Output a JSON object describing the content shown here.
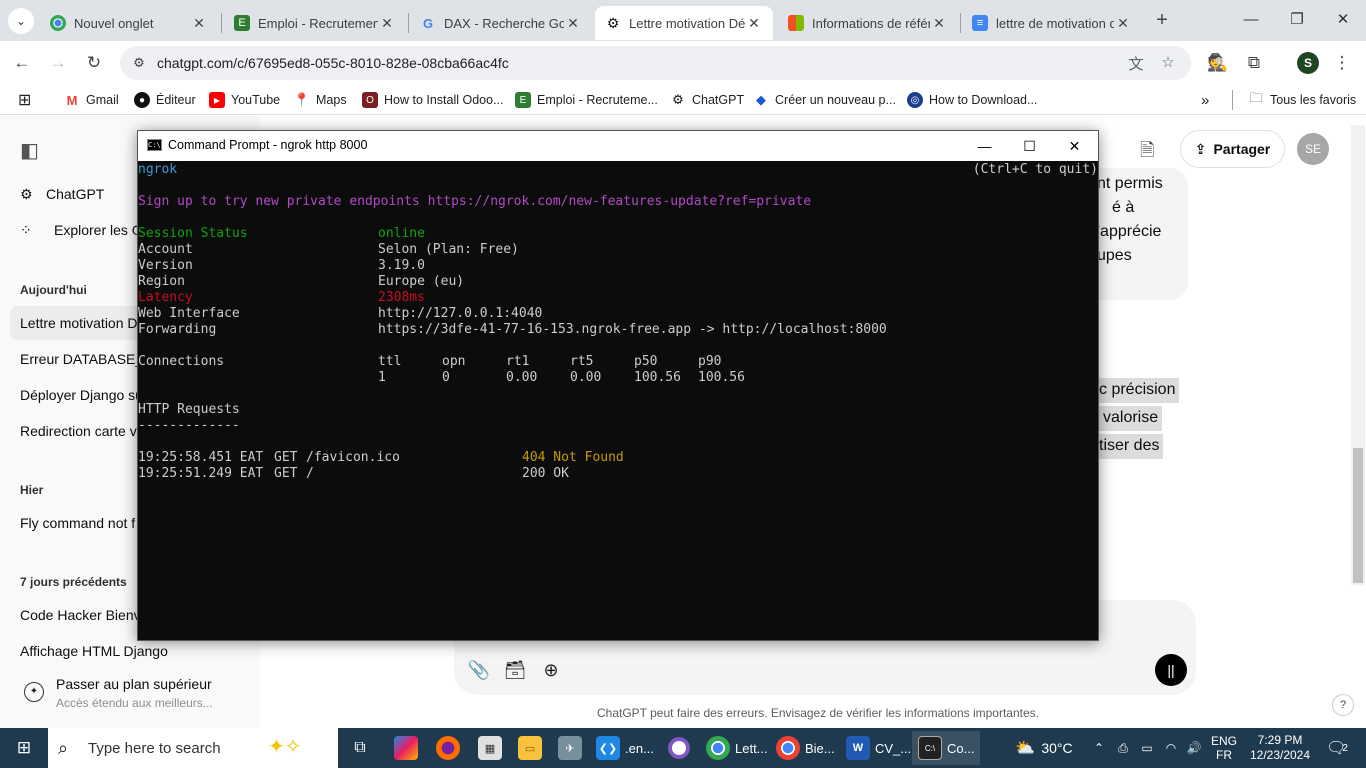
{
  "browser": {
    "tabs": [
      {
        "title": "Nouvel onglet",
        "icon": "chrome-icon"
      },
      {
        "title": "Emploi - Recrutement",
        "icon": "emploi-icon"
      },
      {
        "title": "DAX - Recherche Google",
        "icon": "google-icon"
      },
      {
        "title": "Lettre motivation Dé",
        "icon": "chatgpt-icon",
        "active": true
      },
      {
        "title": "Informations de référ",
        "icon": "microsoft-icon"
      },
      {
        "title": "lettre de motivation d",
        "icon": "docs-icon"
      }
    ],
    "url": "chatgpt.com/c/67695ed8-055c-8010-828e-08cba66ac4fc",
    "profile_initial": "S",
    "bookmarks": [
      {
        "label": "Gmail",
        "icon": "gmail-icon",
        "color": "#ea4335"
      },
      {
        "label": "Éditeur",
        "icon": "editor-icon",
        "color": "#111111"
      },
      {
        "label": "YouTube",
        "icon": "youtube-icon",
        "color": "#ff0000"
      },
      {
        "label": "Maps",
        "icon": "maps-icon",
        "color": "#34a853"
      },
      {
        "label": "How to Install Odoo...",
        "icon": "odoo-icon",
        "color": "#7a1f1f"
      },
      {
        "label": "Emploi - Recruteme...",
        "icon": "emploi-icon",
        "color": "#2e7d32"
      },
      {
        "label": "ChatGPT",
        "icon": "chatgpt-icon",
        "color": "#111111"
      },
      {
        "label": "Créer un nouveau p...",
        "icon": "diamond-icon",
        "color": "#1a56db"
      },
      {
        "label": "How to Download...",
        "icon": "globe-icon",
        "color": "#1a3d8f"
      }
    ],
    "all_bookmarks": "Tous les favoris"
  },
  "chatgpt": {
    "nav": [
      {
        "label": "ChatGPT",
        "icon": "chatgpt-icon"
      },
      {
        "label": "Explorer les G",
        "icon": "grid-icon"
      }
    ],
    "sections": [
      {
        "heading": "Aujourd'hui",
        "items": [
          "Lettre motivation D",
          "Erreur DATABASE_U",
          "Déployer Django su",
          "Redirection carte ve"
        ]
      },
      {
        "heading": "Hier",
        "items": [
          "Fly command not f"
        ]
      },
      {
        "heading": "7 jours précédents",
        "items": [
          "Code Hacker Bienv",
          "Affichage HTML Django"
        ]
      }
    ],
    "upgrade": {
      "title": "Passer au plan supérieur",
      "subtitle": "Accès étendu aux meilleurs..."
    },
    "share_label": "Partager",
    "user_initials": "SE",
    "visible_text_right": [
      "nt permis",
      "é à",
      "'apprécie",
      "upes",
      "c précision",
      "valorise",
      "tiser des"
    ],
    "disclaimer": "ChatGPT peut faire des erreurs. Envisagez de vérifier les informations importantes.",
    "help": "?"
  },
  "cmd": {
    "title": "Command Prompt - ngrok  http 8000",
    "header_left": "ngrok",
    "header_right": "(Ctrl+C to quit)",
    "promo": "Sign up to try new private endpoints https://ngrok.com/new-features-update?ref=private",
    "status": [
      {
        "key": "Session Status",
        "value": "online",
        "style": "green"
      },
      {
        "key": "Account",
        "value": "Selon (Plan: Free)",
        "style": ""
      },
      {
        "key": "Version",
        "value": "3.19.0",
        "style": ""
      },
      {
        "key": "Region",
        "value": "Europe (eu)",
        "style": ""
      },
      {
        "key": "Latency",
        "value": "2308ms",
        "style": "red"
      },
      {
        "key": "Web Interface",
        "value": "http://127.0.0.1:4040",
        "style": ""
      },
      {
        "key": "Forwarding",
        "value": "https://3dfe-41-77-16-153.ngrok-free.app -> http://localhost:8000",
        "style": ""
      }
    ],
    "connections": {
      "label": "Connections",
      "headers": [
        "ttl",
        "opn",
        "rt1",
        "rt5",
        "p50",
        "p90"
      ],
      "values": [
        "1",
        "0",
        "0.00",
        "0.00",
        "100.56",
        "100.56"
      ]
    },
    "http_heading": "HTTP Requests",
    "http_rule": "-------------",
    "requests": [
      {
        "time": "19:25:58.451 EAT",
        "method": "GET",
        "path": "/favicon.ico",
        "status": "404 Not Found",
        "style": "yellow"
      },
      {
        "time": "19:25:51.249 EAT",
        "method": "GET",
        "path": "/",
        "status": "200 OK",
        "style": ""
      }
    ]
  },
  "taskbar": {
    "search_placeholder": "Type here to search",
    "apps": [
      {
        "label": ".en...",
        "icon": "vscode-icon",
        "color": "#1e88e5"
      },
      {
        "label": "Lett...",
        "icon": "chrome-icon",
        "color": "#34a853"
      },
      {
        "label": "Bie...",
        "icon": "chrome-icon",
        "color": "#34a853"
      },
      {
        "label": "CV_...",
        "icon": "word-icon",
        "color": "#1f5bb5"
      },
      {
        "label": "Co...",
        "icon": "cmd-icon",
        "color": "#222222"
      }
    ],
    "temperature": "30°C",
    "language": "ENG",
    "layout": "FR",
    "time": "7:29 PM",
    "date": "12/23/2024",
    "notification_count": "2"
  }
}
